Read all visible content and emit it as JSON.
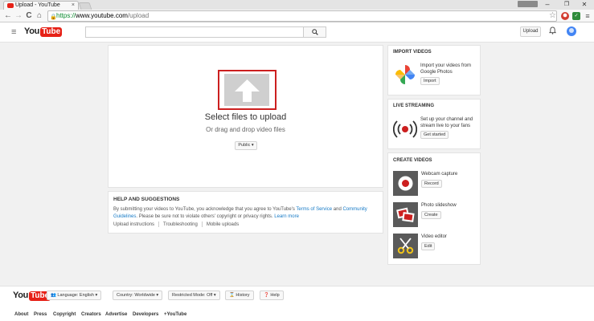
{
  "browser": {
    "tab_title": "Upload - YouTube",
    "tab_close": "×",
    "user_chip": "",
    "window_controls": {
      "minimize": "–",
      "restore": "❐",
      "close": "✕"
    },
    "nav": {
      "back": "←",
      "forward": "→",
      "reload": "C",
      "home": "⌂"
    },
    "url": {
      "scheme": "https://",
      "host": "www.youtube.com",
      "path": "/upload"
    },
    "star": "☆"
  },
  "header": {
    "logo_you": "You",
    "logo_tube": "Tube",
    "search_placeholder": "",
    "upload_label": "Upload"
  },
  "upload": {
    "select_label": "Select files to upload",
    "drag_label": "Or drag and drop video files",
    "privacy_value": "Public ▾"
  },
  "help": {
    "title": "HELP AND SUGGESTIONS",
    "text_before": "By submitting your videos to YouTube, you acknowledge that you agree to YouTube's ",
    "terms_link": "Terms of Service",
    "text_and": " and ",
    "guidelines_link": "Community Guidelines",
    "text_after": ". Please be sure not to violate others' copyright or privacy rights. ",
    "learn_more": "Learn more",
    "links": [
      "Upload instructions",
      "Troubleshooting",
      "Mobile uploads"
    ]
  },
  "import_videos": {
    "title": "IMPORT VIDEOS",
    "description": "Import your videos from Google Photos",
    "button": "Import"
  },
  "live_streaming": {
    "title": "LIVE STREAMING",
    "description": "Set up your channel and stream live to your fans",
    "button": "Get started"
  },
  "create_videos": {
    "title": "CREATE VIDEOS",
    "items": [
      {
        "label": "Webcam capture",
        "button": "Record"
      },
      {
        "label": "Photo slideshow",
        "button": "Create"
      },
      {
        "label": "Video editor",
        "button": "Edit"
      }
    ]
  },
  "footer": {
    "logo_you": "You",
    "logo_tube": "Tube",
    "language": "Language: English ▾",
    "country": "Country: Worldwide ▾",
    "restricted": "Restricted Mode: Off ▾",
    "history": "History",
    "help": "Help",
    "links": [
      "About",
      "Press",
      "Copyright",
      "Creators",
      "Advertise",
      "Developers",
      "+YouTube"
    ]
  },
  "colors": {
    "brand_red": "#e62117",
    "link_blue": "#167ac6",
    "highlight_border": "#cc1f1f"
  }
}
